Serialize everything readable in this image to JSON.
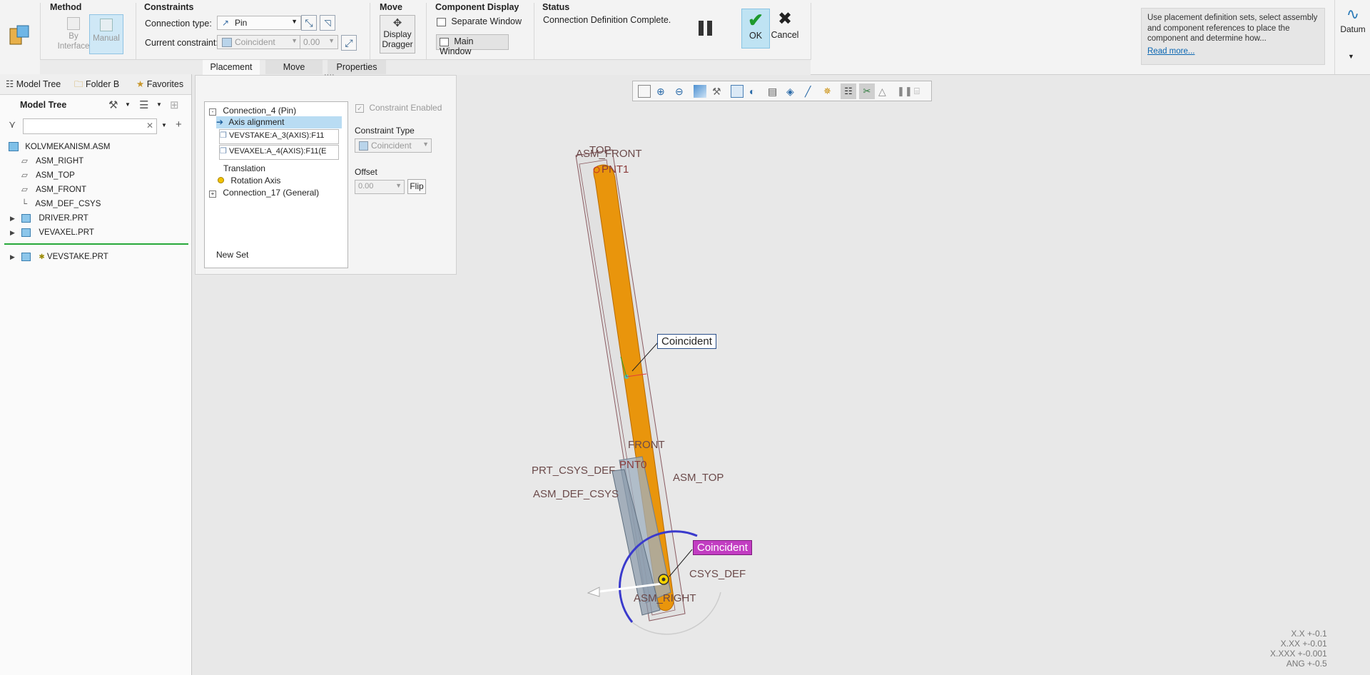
{
  "ribbon": {
    "method": {
      "title": "Method",
      "by_interface": "By\nInterface",
      "manual": "Manual"
    },
    "constraints": {
      "title": "Constraints",
      "connection_type_label": "Connection type:",
      "connection_type_value": "Pin",
      "current_constraint_label": "Current constraint:",
      "current_constraint_value": "Coincident",
      "offset_value": "0.00"
    },
    "move": {
      "title": "Move",
      "display_dragger": "Display\nDragger"
    },
    "component_display": {
      "title": "Component Display",
      "separate_window": "Separate Window",
      "main_window": "Main Window"
    },
    "status": {
      "title": "Status",
      "text": "Connection Definition Complete."
    },
    "ok": "OK",
    "cancel": "Cancel",
    "help_text": "Use placement definition sets, select assembly and component references to place the component and determine how...",
    "read_more": "Read more...",
    "datum": "Datum",
    "subtabs": [
      "Placement",
      "Move",
      "Properties"
    ]
  },
  "left_panel": {
    "tabs": [
      "Model Tree",
      "Folder B",
      "Favorites"
    ],
    "header": "Model Tree",
    "search_placeholder": "",
    "items": [
      "KOLVMEKANISM.ASM",
      "ASM_RIGHT",
      "ASM_TOP",
      "ASM_FRONT",
      "ASM_DEF_CSYS",
      "DRIVER.PRT",
      "VEVAXEL.PRT",
      "VEVSTAKE.PRT"
    ]
  },
  "placement": {
    "connection_4": "Connection_4 (Pin)",
    "axis_alignment": "Axis alignment",
    "ref1": "VEVSTAKE:A_3(AXIS):F11",
    "ref2": "VEVAXEL:A_4(AXIS):F11(E",
    "translation": "Translation",
    "rotation_axis": "Rotation Axis",
    "connection_17": "Connection_17 (General)",
    "new_set": "New Set",
    "constraint_enabled": "Constraint Enabled",
    "constraint_type_label": "Constraint Type",
    "constraint_type_value": "Coincident",
    "offset_label": "Offset",
    "offset_value": "0.00",
    "flip": "Flip"
  },
  "graphics": {
    "labels": {
      "top": "TOP",
      "asm_front": "ASM_FRONT",
      "pnt1": "PNT1",
      "front": "FRONT",
      "pnt0": "PNT0",
      "prt_csys_def": "PRT_CSYS_DEF",
      "asm_def_csys": "ASM_DEF_CSYS",
      "asm_top": "ASM_TOP",
      "csys_def": "CSYS_DEF",
      "asm_right": "ASM_RIGHT"
    },
    "callout1": "Coincident",
    "callout2": "Coincident",
    "tolerance": [
      "X.X +-0.1",
      "X.XX +-0.01",
      "X.XXX +-0.001",
      "ANG +-0.5"
    ]
  },
  "colors": {
    "accent": "#0a66b2",
    "orange": "#e9950c",
    "callout_magenta": "#c23dc2",
    "ok_bg": "#bfe3f3"
  }
}
